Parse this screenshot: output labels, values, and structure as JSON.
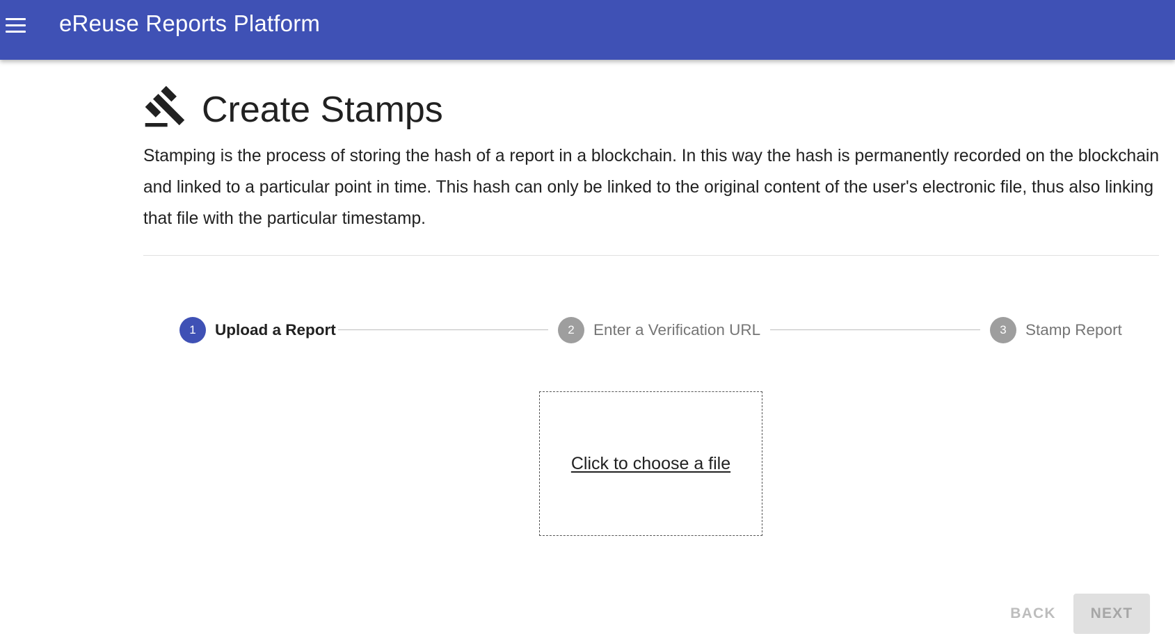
{
  "appbar": {
    "title": "eReuse Reports Platform",
    "background_color": "#3f51b5",
    "menu_icon": "hamburger-menu-icon"
  },
  "page": {
    "title": "Create Stamps",
    "title_icon": "gavel-icon",
    "description": "Stamping is the process of storing the hash of a report in a blockchain. In this way the hash is permanently recorded on the blockchain and linked to a particular point in time. This hash can only be linked to the original content of the user's electronic file, thus also linking that file with the particular timestamp."
  },
  "stepper": {
    "steps": [
      {
        "number": "1",
        "label": "Upload a Report",
        "state": "active"
      },
      {
        "number": "2",
        "label": "Enter a Verification URL",
        "state": "inactive"
      },
      {
        "number": "3",
        "label": "Stamp Report",
        "state": "inactive"
      }
    ],
    "active_color": "#3f51b5",
    "inactive_color": "#9e9e9e"
  },
  "upload": {
    "link_text": "Click to choose a file"
  },
  "actions": {
    "back_label": "BACK",
    "next_label": "NEXT"
  }
}
